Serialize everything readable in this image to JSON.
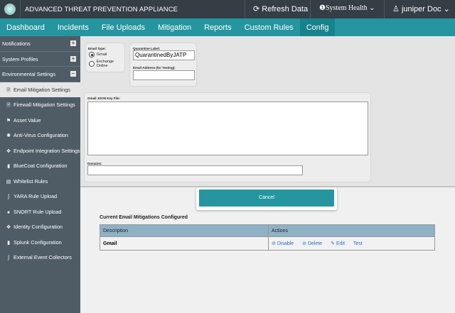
{
  "header": {
    "title": "ADVANCED THREAT PREVENTION APPLIANCE",
    "refresh": "Refresh Data",
    "system_health": "System Health",
    "user": "juniper Doc"
  },
  "nav": [
    "Dashboard",
    "Incidents",
    "File Uploads",
    "Mitigation",
    "Reports",
    "Custom Rules",
    "Config"
  ],
  "active_nav": "Config",
  "sidebar": {
    "sections": [
      {
        "label": "Notifications",
        "toggle": "+"
      },
      {
        "label": "System Profiles",
        "toggle": "+"
      },
      {
        "label": "Environmental Settings",
        "toggle": "−"
      }
    ],
    "items": [
      {
        "label": "Email Mitigation Settings",
        "icon": "doc-icon",
        "glyph": "🗎"
      },
      {
        "label": "Firewall Mitigation Settings",
        "icon": "doc-icon",
        "glyph": "🗎"
      },
      {
        "label": "Asset Value",
        "icon": "flag-icon",
        "glyph": "⚑"
      },
      {
        "label": "Anti-Virus Configuration",
        "icon": "virus-icon",
        "glyph": "✺"
      },
      {
        "label": "Endpoint Integration Settings",
        "icon": "endpoint-icon",
        "glyph": "✥"
      },
      {
        "label": "BlueCoat Configuration",
        "icon": "shield-icon",
        "glyph": "▮"
      },
      {
        "label": "Whitelist Rules",
        "icon": "list-icon",
        "glyph": "▤"
      },
      {
        "label": "YARA Rule Upload",
        "icon": "script-icon",
        "glyph": "ʃ"
      },
      {
        "label": "SNORT Rule Upload",
        "icon": "pig-icon",
        "glyph": "●"
      },
      {
        "label": "Identity Configuration",
        "icon": "identity-icon",
        "glyph": "✥"
      },
      {
        "label": "Splunk Configuration",
        "icon": "shield-icon",
        "glyph": "▮"
      },
      {
        "label": "External Event Collectors",
        "icon": "script-icon",
        "glyph": "ʃ"
      }
    ]
  },
  "form": {
    "email_type_label": "Email Type:",
    "options": [
      "Gmail",
      "Exchange Online"
    ],
    "selected": "Gmail",
    "quarantine_label": "Quarantine Label:",
    "quarantine_value": "QuarantinedByJATP",
    "email_address_label": "Email Address (for Testing):",
    "email_address_value": "",
    "json_key_label": "Gmail JSON Key File:",
    "json_key_value": "",
    "domains_label": "Domains:",
    "domains_value": "",
    "cancel": "Cancel"
  },
  "table": {
    "title": "Current Email Mitigations Configured",
    "columns": [
      "Description",
      "Actions"
    ],
    "rows": [
      {
        "description": "Gmail",
        "actions": [
          "Disable",
          "Delete",
          "Edit",
          "Test"
        ]
      }
    ]
  }
}
